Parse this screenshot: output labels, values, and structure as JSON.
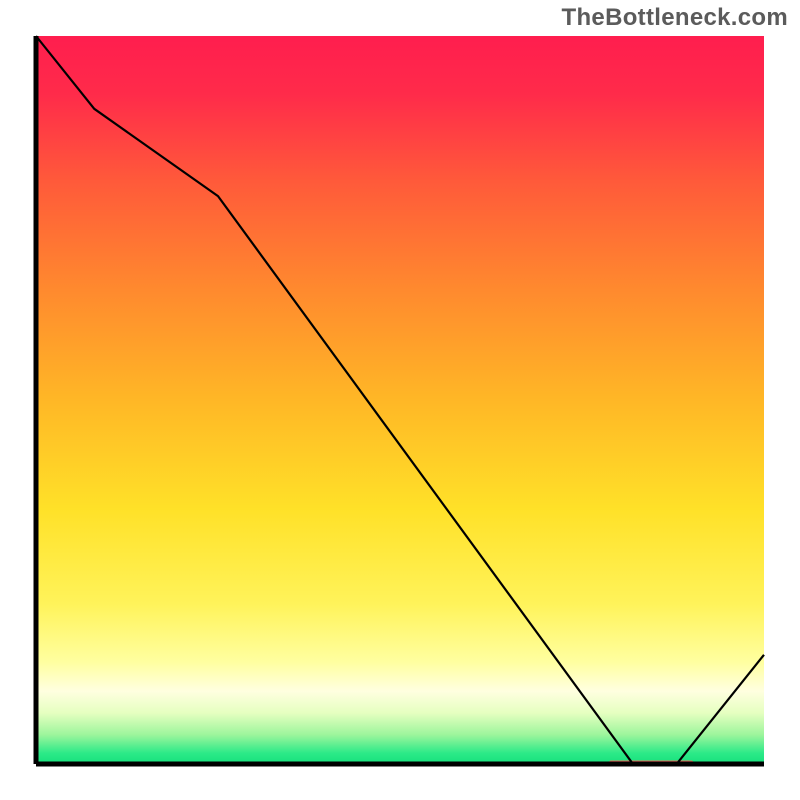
{
  "watermark": "TheBottleneck.com",
  "chart_data": {
    "type": "line",
    "title": "",
    "xlabel": "",
    "ylabel": "",
    "xlim": [
      0,
      100
    ],
    "ylim": [
      0,
      100
    ],
    "series": [
      {
        "name": "curve",
        "x": [
          0,
          8,
          25,
          82,
          88,
          100
        ],
        "y": [
          100,
          90,
          78,
          0,
          0,
          15
        ]
      }
    ],
    "highlight_segment": {
      "x_start": 79,
      "x_end": 90,
      "y": 0
    },
    "gradient_stops": [
      {
        "offset": 0.0,
        "color": "#ff1e4e"
      },
      {
        "offset": 0.08,
        "color": "#ff2b4a"
      },
      {
        "offset": 0.2,
        "color": "#ff5a3a"
      },
      {
        "offset": 0.35,
        "color": "#ff8a2e"
      },
      {
        "offset": 0.5,
        "color": "#ffb726"
      },
      {
        "offset": 0.65,
        "color": "#ffe128"
      },
      {
        "offset": 0.78,
        "color": "#fff35a"
      },
      {
        "offset": 0.86,
        "color": "#ffffa0"
      },
      {
        "offset": 0.9,
        "color": "#ffffe0"
      },
      {
        "offset": 0.93,
        "color": "#e5ffc0"
      },
      {
        "offset": 0.96,
        "color": "#9cf59c"
      },
      {
        "offset": 0.985,
        "color": "#2cea88"
      },
      {
        "offset": 1.0,
        "color": "#16e07c"
      }
    ],
    "axis_color": "#000000",
    "curve_color": "#000000",
    "highlight_color": "#ef6a5e"
  }
}
